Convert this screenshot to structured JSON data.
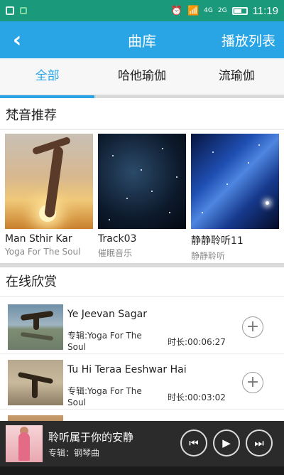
{
  "status_bar": {
    "time": "11:19",
    "sig1": "4G",
    "sig2": "2G"
  },
  "header": {
    "title": "曲库",
    "playlist_label": "播放列表"
  },
  "tabs": [
    {
      "label": "全部"
    },
    {
      "label": "哈他瑜伽"
    },
    {
      "label": "流瑜伽"
    }
  ],
  "recommend": {
    "title": "梵音推荐",
    "items": [
      {
        "title": "Man Sthir Kar",
        "subtitle": "Yoga For The Soul"
      },
      {
        "title": "Track03",
        "subtitle": "催眠音乐"
      },
      {
        "title": "静静聆听11",
        "subtitle": "静静聆听"
      }
    ]
  },
  "online": {
    "title": "在线欣赏",
    "items": [
      {
        "name": "Ye Jeevan Sagar",
        "album": "专辑:Yoga For The Soul",
        "duration": "时长:00:06:27"
      },
      {
        "name": "Tu Hi Teraa Eeshwar Hai",
        "album": "专辑:Yoga For The Soul",
        "duration": "时长:00:03:02"
      }
    ]
  },
  "player": {
    "song": "聆听属于你的安静",
    "album": "专辑：钢琴曲"
  },
  "colors": {
    "status": "#1a9a7a",
    "header": "#29a5e6",
    "player": "#2b2b2b"
  }
}
